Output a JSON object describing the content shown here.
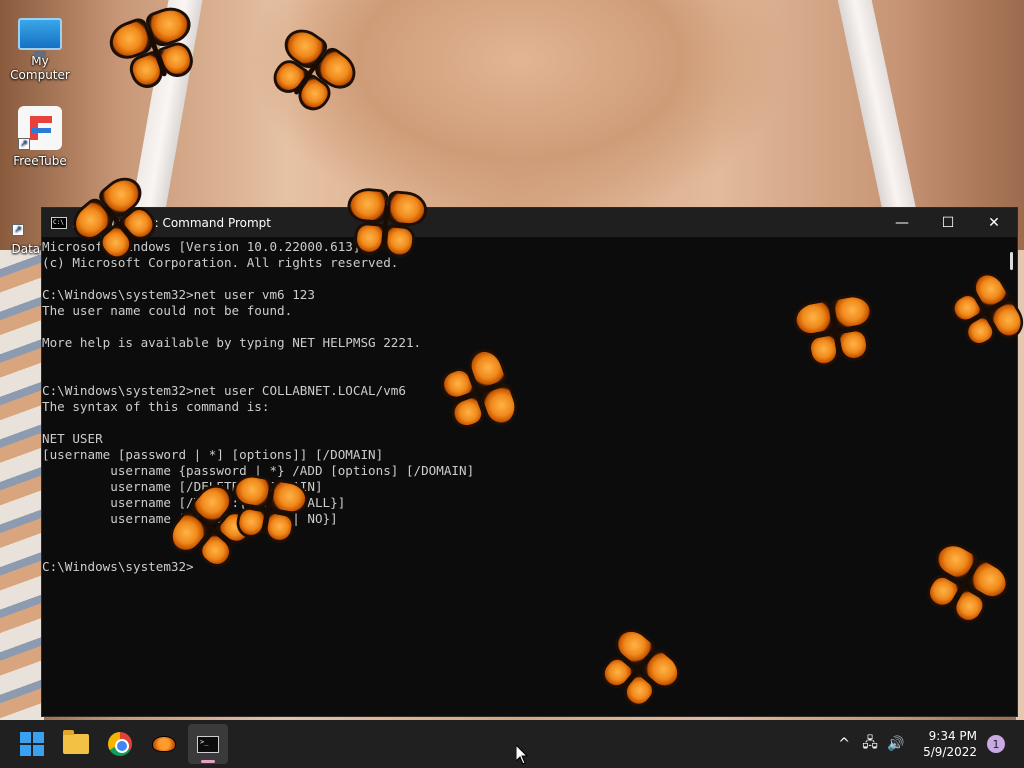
{
  "desktop": {
    "icons": [
      {
        "label": "My Computer"
      },
      {
        "label": "FreeTube"
      },
      {
        "label": "DataW"
      }
    ]
  },
  "window": {
    "title": "Administrator: Command Prompt",
    "controls": {
      "minimize": "—",
      "maximize": "☐",
      "close": "✕"
    }
  },
  "terminal": {
    "lines": [
      "Microsoft Windows [Version 10.0.22000.613]",
      "(c) Microsoft Corporation. All rights reserved.",
      "",
      "C:\\Windows\\system32>net user vm6 123",
      "The user name could not be found.",
      "",
      "More help is available by typing NET HELPMSG 2221.",
      "",
      "",
      "C:\\Windows\\system32>net user COLLABNET.LOCAL/vm6",
      "The syntax of this command is:",
      "",
      "NET USER",
      "[username [password | *] [options]] [/DOMAIN]",
      "         username {password | *} /ADD [options] [/DOMAIN]",
      "         username [/DELETE] [/DOMAIN]",
      "         username [/TIMES:{times | ALL}]",
      "         username [/ACTIVE: {YES | NO}]",
      "",
      "",
      "C:\\Windows\\system32>"
    ]
  },
  "taskbar": {
    "clock": {
      "time": "9:34 PM",
      "date": "5/9/2022"
    },
    "notification_count": "1",
    "tray": {
      "chevron": "^",
      "network": "🖧",
      "volume": "🔊"
    }
  }
}
